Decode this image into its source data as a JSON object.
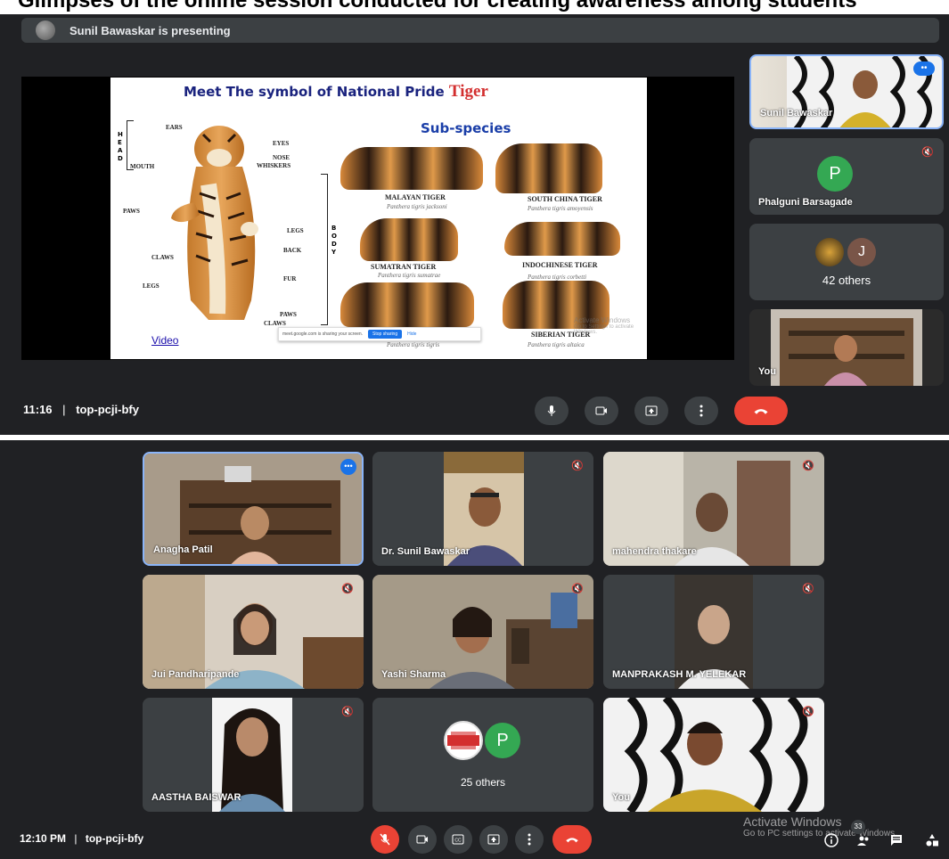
{
  "caption": "Glimpses of the online session conducted for creating awareness among students",
  "top": {
    "presenting_banner": "Sunil Bawaskar is presenting",
    "slide": {
      "title_prefix": "Meet The symbol of National Pride",
      "title_accent": "Tiger",
      "subspecies_heading": "Sub-species",
      "side_head": "HEAD",
      "side_body": "BODY",
      "labels_left": [
        "EARS",
        "MOUTH",
        "PAWS",
        "CLAWS",
        "LEGS"
      ],
      "labels_right": [
        "EYES",
        "NOSE",
        "WHISKERS",
        "LEGS",
        "BACK",
        "FUR",
        "PAWS",
        "CLAWS"
      ],
      "species": [
        {
          "name": "MALAYAN TIGER",
          "latin": "Panthera tigris jacksoni"
        },
        {
          "name": "SOUTH CHINA TIGER",
          "latin": "Panthera tigris amoyensis"
        },
        {
          "name": "SUMATRAN TIGER",
          "latin": "Panthera tigris sumatrae"
        },
        {
          "name": "INDOCHINESE TIGER",
          "latin": "Panthera tigris corbetti"
        },
        {
          "name": "",
          "latin": "Panthera tigris tigris"
        },
        {
          "name": "SIBERIAN TIGER",
          "latin": "Panthera tigris altaica"
        }
      ],
      "video_link": "Video",
      "share_notice": "meet.google.com is sharing your screen.",
      "stop_sharing": "Stop sharing",
      "hide": "Hide",
      "activate_l1": "Activate Windows",
      "activate_l2": "Go to Settings to activate Windows."
    },
    "participants": [
      {
        "name": "Sunil Bawaskar"
      },
      {
        "name": "Phalguni Barsagade",
        "initial": "P"
      },
      {
        "name": "42 others",
        "initial": "J"
      },
      {
        "name": "You"
      }
    ],
    "footer": {
      "time": "11:16",
      "sep": "|",
      "code": "top-pcji-bfy"
    }
  },
  "bottom": {
    "tiles": [
      {
        "name": "Anagha Patil"
      },
      {
        "name": "Dr. Sunil Bawaskar"
      },
      {
        "name": "mahendra thakare"
      },
      {
        "name": "Jui Pandharipande"
      },
      {
        "name": "Yashi Sharma"
      },
      {
        "name": "MANPRAKASH M. YELEKAR"
      },
      {
        "name": "AASTHA BAISWAR"
      },
      {
        "name": "25 others",
        "initial": "P",
        "badge_text": "THE DEAS CAMPAIGN"
      },
      {
        "name": "You"
      }
    ],
    "footer": {
      "time": "12:10 PM",
      "sep": "|",
      "code": "top-pcji-bfy"
    },
    "people_count": "33",
    "activate_l1": "Activate Windows",
    "activate_l2": "Go to PC settings to activate Windows."
  },
  "colors": {
    "bg": "#202124",
    "tile": "#3c4043",
    "hangup": "#ea4335",
    "accent": "#1a73e8",
    "avatar_green": "#34a853",
    "avatar_brown": "#795548"
  }
}
